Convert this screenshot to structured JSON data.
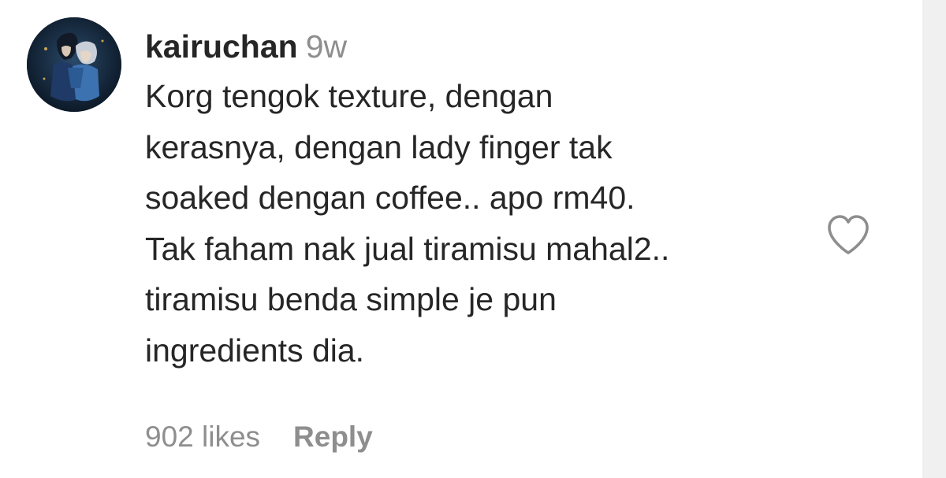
{
  "comment": {
    "username": "kairuchan",
    "timestamp": "9w",
    "text_lines": [
      "Korg tengok texture, dengan",
      "kerasnya, dengan lady finger tak",
      "soaked dengan coffee.. apo rm40.",
      "Tak faham nak jual tiramisu mahal2..",
      "tiramisu benda simple je pun",
      "ingredients dia."
    ],
    "likes_label": "902 likes",
    "reply_label": "Reply",
    "like_icon": "heart-outline-icon",
    "avatar_icon": "anime-avatar"
  },
  "colors": {
    "text_primary": "#262626",
    "text_secondary": "#8e8e8e",
    "background": "#ffffff"
  }
}
